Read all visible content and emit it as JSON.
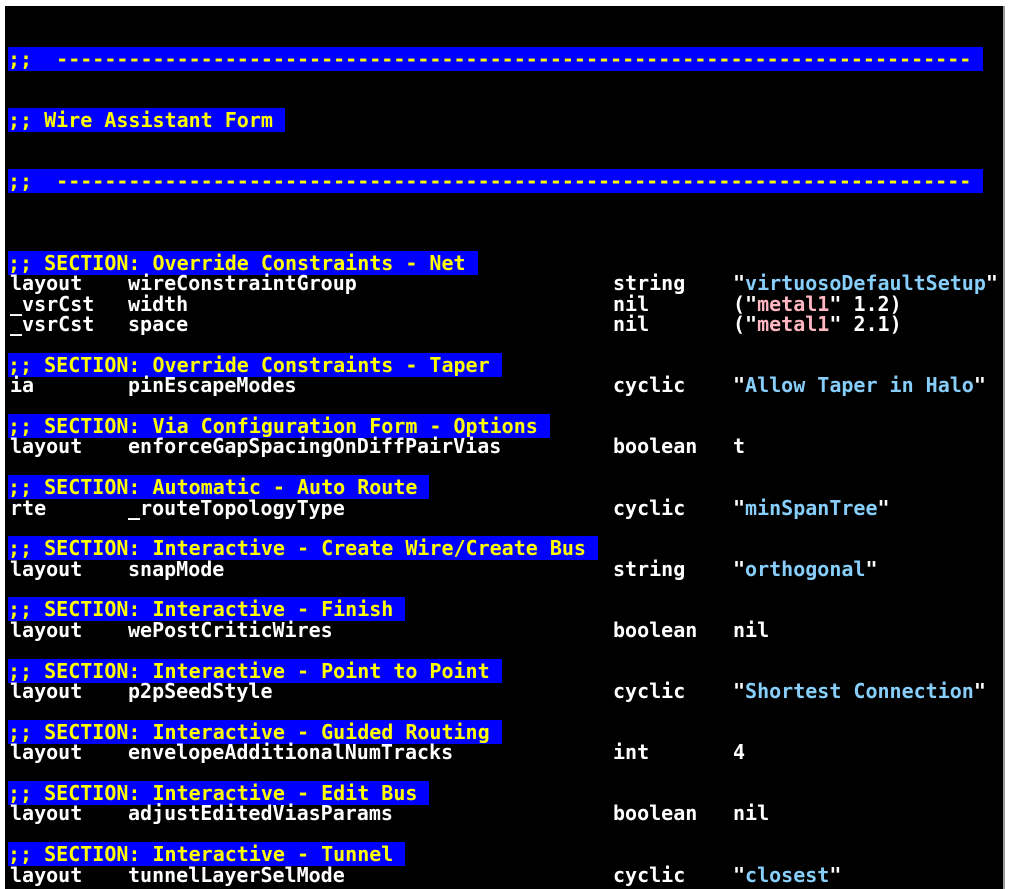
{
  "colors": {
    "background": "#000000",
    "highlight_bg": "#0000ff",
    "comment": "#ffff00",
    "text": "#ffffff",
    "string": "#87cefa",
    "list_string": "#ffb6c1"
  },
  "header": {
    "rule_top": ";;  ---------------------------------------------------------------------------- ",
    "title": ";; Wire Assistant Form ",
    "rule_bottom": ";;  ---------------------------------------------------------------------------- "
  },
  "sections": [
    {
      "title": ";; SECTION: Override Constraints - Net ",
      "rows": [
        {
          "tool": "layout",
          "name": "wireConstraintGroup",
          "type": "string",
          "value": {
            "kind": "string",
            "text": "virtuosoDefaultSetup"
          }
        },
        {
          "tool": "_vsrCst",
          "name": "width",
          "type": "nil",
          "value": {
            "kind": "list",
            "text": "metal1",
            "num": "1.2"
          }
        },
        {
          "tool": "_vsrCst",
          "name": "space",
          "type": "nil",
          "value": {
            "kind": "list",
            "text": "metal1",
            "num": "2.1"
          }
        }
      ]
    },
    {
      "title": ";; SECTION: Override Constraints - Taper ",
      "rows": [
        {
          "tool": "ia",
          "name": "pinEscapeModes",
          "type": "cyclic",
          "value": {
            "kind": "string",
            "text": "Allow Taper in Halo"
          }
        }
      ]
    },
    {
      "title": ";; SECTION: Via Configuration Form - Options ",
      "rows": [
        {
          "tool": "layout",
          "name": "enforceGapSpacingOnDiffPairVias",
          "type": "boolean",
          "value": {
            "kind": "plain",
            "text": "t"
          }
        }
      ]
    },
    {
      "title": ";; SECTION: Automatic - Auto Route ",
      "rows": [
        {
          "tool": "rte",
          "name": "_routeTopologyType",
          "type": "cyclic",
          "value": {
            "kind": "string",
            "text": "minSpanTree"
          }
        }
      ]
    },
    {
      "title": ";; SECTION: Interactive - Create Wire/Create Bus ",
      "rows": [
        {
          "tool": "layout",
          "name": "snapMode",
          "type": "string",
          "value": {
            "kind": "string",
            "text": "orthogonal"
          }
        }
      ]
    },
    {
      "title": ";; SECTION: Interactive - Finish ",
      "rows": [
        {
          "tool": "layout",
          "name": "wePostCriticWires",
          "type": "boolean",
          "value": {
            "kind": "plain",
            "text": "nil"
          }
        }
      ]
    },
    {
      "title": ";; SECTION: Interactive - Point to Point ",
      "rows": [
        {
          "tool": "layout",
          "name": "p2pSeedStyle",
          "type": "cyclic",
          "value": {
            "kind": "string",
            "text": "Shortest Connection"
          }
        }
      ]
    },
    {
      "title": ";; SECTION: Interactive - Guided Routing ",
      "rows": [
        {
          "tool": "layout",
          "name": "envelopeAdditionalNumTracks",
          "type": "int",
          "value": {
            "kind": "plain",
            "text": "4"
          }
        }
      ]
    },
    {
      "title": ";; SECTION: Interactive - Edit Bus ",
      "rows": [
        {
          "tool": "layout",
          "name": "adjustEditedViasParams",
          "type": "boolean",
          "value": {
            "kind": "plain",
            "text": "nil"
          }
        }
      ]
    },
    {
      "title": ";; SECTION: Interactive - Tunnel ",
      "rows": [
        {
          "tool": "layout",
          "name": "tunnelLayerSelMode",
          "type": "cyclic",
          "value": {
            "kind": "string",
            "text": "closest"
          }
        }
      ]
    }
  ]
}
